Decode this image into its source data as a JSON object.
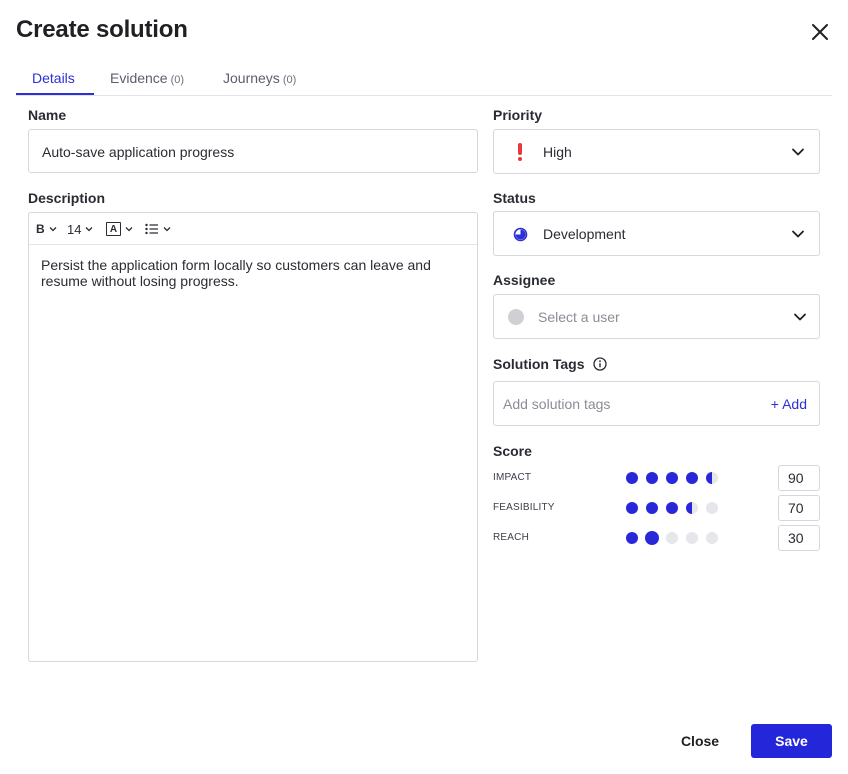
{
  "dialog": {
    "title": "Create solution",
    "save_label": "Save",
    "close_label": "Close"
  },
  "tabs": [
    {
      "label": "Details",
      "count": ""
    },
    {
      "label": "Evidence",
      "count": "(0)"
    },
    {
      "label": "Journeys",
      "count": "(0)"
    }
  ],
  "form": {
    "name_label": "Name",
    "name_value": "Auto-save application progress",
    "description_label": "Description",
    "description_value": "Persist the application form locally so customers can leave and resume without losing progress.",
    "toolbar": {
      "bold_glyph": "B",
      "font_size": "14",
      "text_color_glyph": "A"
    },
    "priority_label": "Priority",
    "priority_value": "High",
    "status_label": "Status",
    "status_value": "Development",
    "assignee_label": "Assignee",
    "assignee_placeholder": "Select a user",
    "tags_label": "Solution Tags",
    "tags_placeholder": "Add solution tags",
    "tags_add_label": "+ Add",
    "score_label": "Score"
  },
  "scores": [
    {
      "name": "IMPACT",
      "value": "90",
      "level": 4.5
    },
    {
      "name": "FEASIBILITY",
      "value": "70",
      "level": 3.5
    },
    {
      "name": "REACH",
      "value": "30",
      "level": 2
    }
  ],
  "colors": {
    "accent": "#2b31d6",
    "priority_high": "#e8383d",
    "dot_on": "#2828d9",
    "dot_off": "#e6e7ea"
  },
  "icons": {
    "close": "close-icon",
    "priority": "exclamation-icon",
    "status": "pie-progress-icon",
    "assignee": "avatar-placeholder-icon",
    "info": "info-icon",
    "chevron": "chevron-down-icon"
  }
}
